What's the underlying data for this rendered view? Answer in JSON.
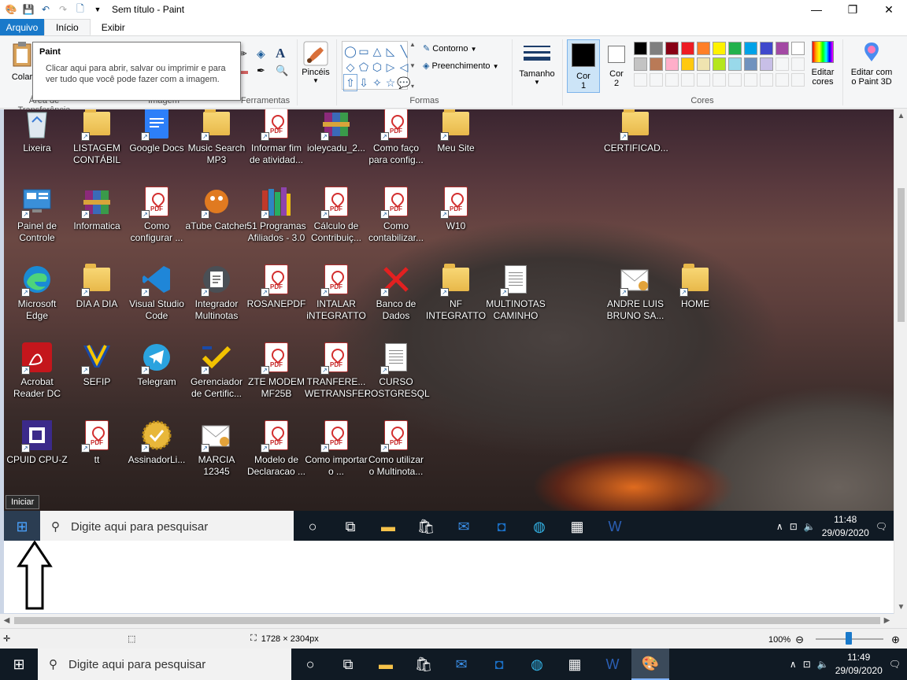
{
  "window": {
    "title": "Sem título - Paint",
    "minimize": "—",
    "maximize": "❐",
    "close": "✕"
  },
  "tabs": {
    "file": "Arquivo",
    "home": "Início",
    "view": "Exibir"
  },
  "ribbon": {
    "paste_label": "Colar",
    "clipboard_group": "Área de Transferência",
    "image_group": "Imagem",
    "tools_group": "Ferramentas",
    "brushes_label": "Pincéis",
    "outline_label": "Contorno",
    "fill_label": "Preenchimento",
    "shapes_group": "Formas",
    "size_label": "Tamanho",
    "color1_label_a": "Cor",
    "color1_label_b": "1",
    "color2_label_a": "Cor",
    "color2_label_b": "2",
    "colors_group": "Cores",
    "edit_colors_a": "Editar",
    "edit_colors_b": "cores",
    "paint3d_a": "Editar com",
    "paint3d_b": "o Paint 3D",
    "palette": [
      "#000000",
      "#7f7f7f",
      "#880015",
      "#ed1c24",
      "#ff7f27",
      "#fff200",
      "#22b14c",
      "#00a2e8",
      "#3f48cc",
      "#a349a4",
      "#ffffff",
      "#c3c3c3",
      "#b97a57",
      "#ffaec9",
      "#ffc90e",
      "#efe4b0",
      "#b5e61d",
      "#99d9ea",
      "#7092be",
      "#c8bfe7"
    ]
  },
  "tooltip": {
    "title": "Paint",
    "body": "Clicar aqui para abrir, salvar ou imprimir e para ver tudo que você pode fazer com a imagem."
  },
  "desktop": {
    "icons": [
      {
        "label": "Lixeira",
        "type": "recycle"
      },
      {
        "label": "LISTAGEM CONTÁBIL",
        "type": "folder"
      },
      {
        "label": "Google Docs",
        "type": "gdocs"
      },
      {
        "label": "Music Search MP3",
        "type": "folder"
      },
      {
        "label": "Informar fim de atividad...",
        "type": "pdf"
      },
      {
        "label": "ioleycadu_2...",
        "type": "winrar"
      },
      {
        "label": "Como faço para config...",
        "type": "pdf"
      },
      {
        "label": "Meu Site",
        "type": "folder"
      },
      {
        "label": "CERTIFICAD...",
        "type": "folder"
      },
      {
        "label": "Painel de Controle",
        "type": "panel"
      },
      {
        "label": "Informatica",
        "type": "winrar"
      },
      {
        "label": "Como configurar ...",
        "type": "pdf"
      },
      {
        "label": "aTube Catcher",
        "type": "atube"
      },
      {
        "label": "51 Programas Afiliados - 3.0",
        "type": "books"
      },
      {
        "label": "Cálculo de Contribuiç...",
        "type": "pdf"
      },
      {
        "label": "Como contabilizar...",
        "type": "pdf"
      },
      {
        "label": "W10",
        "type": "pdf"
      },
      {
        "label": "Microsoft Edge",
        "type": "edge"
      },
      {
        "label": "DIA A DIA",
        "type": "folder"
      },
      {
        "label": "Visual Studio Code",
        "type": "vscode"
      },
      {
        "label": "Integrador Multinotas",
        "type": "integrador"
      },
      {
        "label": "ROSANEPDF",
        "type": "pdf"
      },
      {
        "label": "INTALAR iNTEGRATTO",
        "type": "pdf"
      },
      {
        "label": "Banco de Dados",
        "type": "xmark"
      },
      {
        "label": "NF INTEGRATTO",
        "type": "folder"
      },
      {
        "label": "MULTINOTAS CAMINHO",
        "type": "doc"
      },
      {
        "label": "ANDRE LUIS BRUNO SA...",
        "type": "cert"
      },
      {
        "label": "HOME",
        "type": "folder"
      },
      {
        "label": "Acrobat Reader DC",
        "type": "acrobat"
      },
      {
        "label": "SEFIP",
        "type": "sefip"
      },
      {
        "label": "Telegram",
        "type": "telegram"
      },
      {
        "label": "Gerenciador de Certific...",
        "type": "gerenciador"
      },
      {
        "label": "ZTE MODEM MF25B",
        "type": "pdf"
      },
      {
        "label": "TRANFERE... WETRANSFER",
        "type": "pdf"
      },
      {
        "label": "CURSO POSTGRESQL",
        "type": "doc"
      },
      {
        "label": "CPUID CPU-Z",
        "type": "cpuz"
      },
      {
        "label": "tt",
        "type": "pdf"
      },
      {
        "label": "AssinadorLi...",
        "type": "seal"
      },
      {
        "label": "MARCIA 12345",
        "type": "cert"
      },
      {
        "label": "Modelo de Declaracao ...",
        "type": "pdf"
      },
      {
        "label": "Como importar o ...",
        "type": "pdf"
      },
      {
        "label": "Como utilizar o Multinota...",
        "type": "pdf"
      }
    ],
    "start_tooltip": "Iniciar",
    "search_placeholder": "Digite aqui para pesquisar",
    "clock_time": "11:48",
    "clock_date": "29/09/2020"
  },
  "statusbar": {
    "dimensions": "1728 × 2304px",
    "zoom": "100%"
  },
  "taskbar": {
    "search_placeholder": "Digite aqui para pesquisar",
    "clock_time": "11:49",
    "clock_date": "29/09/2020"
  }
}
